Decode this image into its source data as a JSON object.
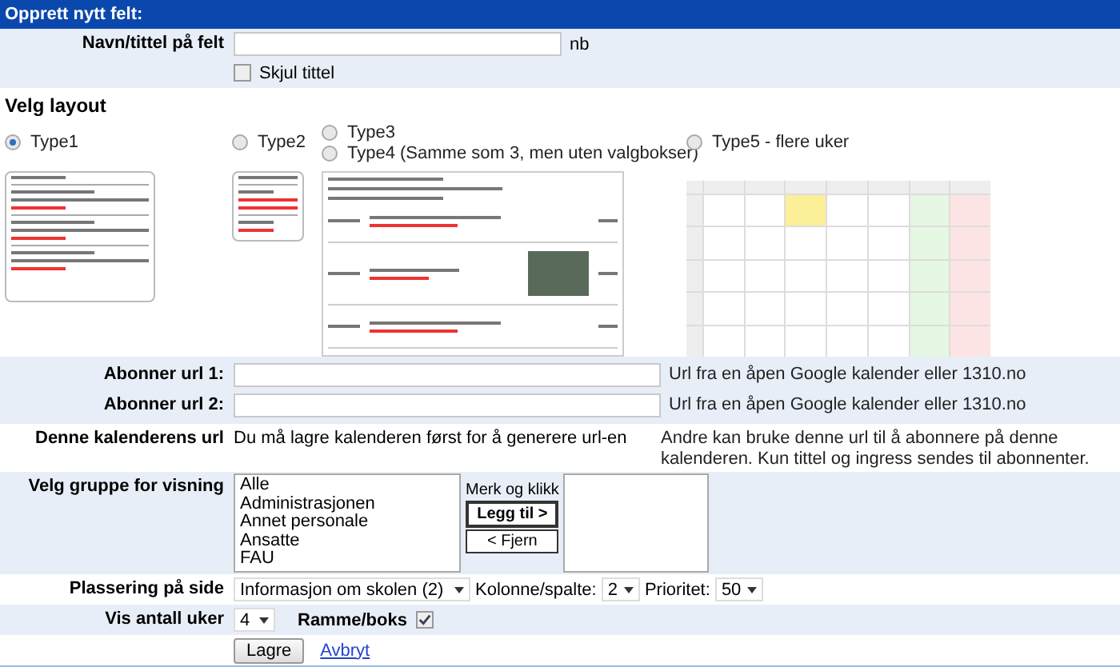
{
  "header": {
    "title": "Opprett nytt felt:"
  },
  "name_field": {
    "label": "Navn/tittel på felt",
    "suffix": "nb",
    "hide_title": {
      "label": "Skjul tittel",
      "checked": false
    }
  },
  "layout": {
    "heading": "Velg layout",
    "groups": [
      {
        "kind": "list",
        "options": [
          {
            "label": "Type1",
            "selected": true
          }
        ]
      },
      {
        "kind": "compact",
        "options": [
          {
            "label": "Type2",
            "selected": false
          }
        ]
      },
      {
        "kind": "table",
        "options": [
          {
            "label": "Type3",
            "selected": false
          },
          {
            "label": "Type4 (Samme som 3, men uten valgbokser)",
            "selected": false
          }
        ]
      },
      {
        "kind": "calendar",
        "options": [
          {
            "label": "Type5 - flere uker",
            "selected": false
          }
        ]
      }
    ]
  },
  "subscribe_urls": [
    {
      "label": "Abonner url 1:",
      "help": "Url fra en åpen Google kalender eller 1310.no"
    },
    {
      "label": "Abonner url 2:",
      "help": "Url fra en åpen Google kalender eller 1310.no"
    }
  ],
  "calendar_url": {
    "label": "Denne kalenderens url",
    "value": "Du må lagre kalenderen først for å generere url-en",
    "help": "Andre kan bruke denne url til å abonnere på denne kalenderen. Kun tittel og ingress sendes til abonnenter."
  },
  "group_select": {
    "label": "Velg gruppe for visning",
    "available": [
      {
        "label": "Alle",
        "selected": false
      },
      {
        "label": "Administrasjonen",
        "selected": false
      },
      {
        "label": "Annet personale",
        "selected": false
      },
      {
        "label": "Ansatte",
        "selected": false
      },
      {
        "label": "FAU",
        "selected": false
      }
    ],
    "instruction": "Merk og klikk",
    "add_button": "Legg til >",
    "remove_button": "< Fjern"
  },
  "placement": {
    "label": "Plassering på side",
    "page": "Informasjon om skolen (2)",
    "column_label": "Kolonne/spalte:",
    "column": "2",
    "priority_label": "Prioritet:",
    "priority": "50"
  },
  "weeks": {
    "label": "Vis antall uker",
    "value": "4",
    "frame": {
      "label": "Ramme/boks",
      "checked": true
    }
  },
  "actions": {
    "save": "Lagre",
    "cancel": "Avbryt"
  }
}
